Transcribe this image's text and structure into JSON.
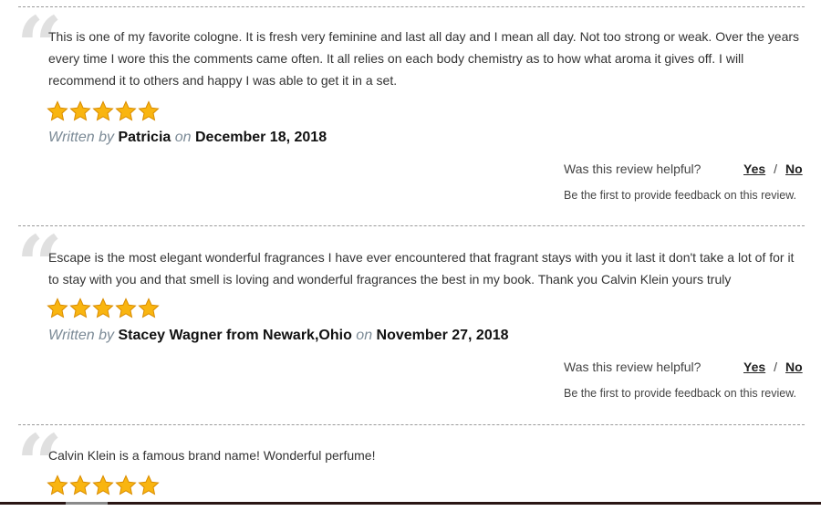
{
  "reviews": [
    {
      "text": "This is one of my favorite cologne. It is fresh very feminine and last all day and I mean all day. Not too strong or weak. Over the years every time I wore this the comments came often. It all relies on each body chemistry as to how what aroma it gives off. I will recommend it to others and happy I was able to get it in a set.",
      "rating": 5,
      "written_by_label": "Written by",
      "author": "Patricia",
      "on_label": "on",
      "date": "December 18, 2018",
      "helpful_question": "Was this review helpful?",
      "yes_label": "Yes",
      "separator": "/",
      "no_label": "No",
      "feedback_note": "Be the first to provide feedback on this review."
    },
    {
      "text": "Escape is the most elegant wonderful fragrances I have ever encountered that fragrant stays with you it last it don't take a lot of for it to stay with you and that smell is loving and wonderful fragrances the best in my book. Thank you Calvin Klein yours truly",
      "rating": 5,
      "written_by_label": "Written by",
      "author": "Stacey Wagner from Newark,Ohio",
      "on_label": "on",
      "date": "November 27, 2018",
      "helpful_question": "Was this review helpful?",
      "yes_label": "Yes",
      "separator": "/",
      "no_label": "No",
      "feedback_note": "Be the first to provide feedback on this review."
    },
    {
      "text": "Calvin Klein is a famous brand name! Wonderful perfume!",
      "rating": 5
    }
  ],
  "colors": {
    "star_fill": "#f9b510",
    "star_stroke": "#d98c00",
    "divider": "#9a9a9a",
    "quote_mark": "#e0e0e0"
  },
  "icons": {
    "quote": "quote-icon",
    "star": "star-icon"
  }
}
